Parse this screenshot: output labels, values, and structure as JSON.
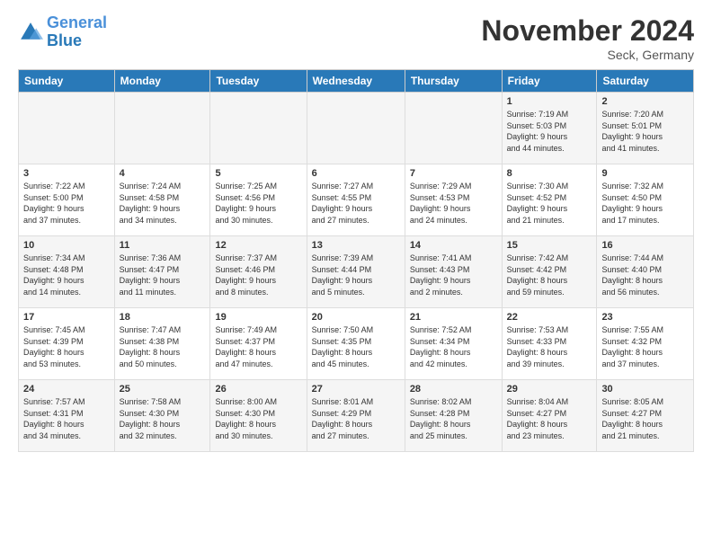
{
  "header": {
    "logo_line1": "General",
    "logo_line2": "Blue",
    "month": "November 2024",
    "location": "Seck, Germany"
  },
  "columns": [
    "Sunday",
    "Monday",
    "Tuesday",
    "Wednesday",
    "Thursday",
    "Friday",
    "Saturday"
  ],
  "weeks": [
    [
      {
        "day": "",
        "info": ""
      },
      {
        "day": "",
        "info": ""
      },
      {
        "day": "",
        "info": ""
      },
      {
        "day": "",
        "info": ""
      },
      {
        "day": "",
        "info": ""
      },
      {
        "day": "1",
        "info": "Sunrise: 7:19 AM\nSunset: 5:03 PM\nDaylight: 9 hours\nand 44 minutes."
      },
      {
        "day": "2",
        "info": "Sunrise: 7:20 AM\nSunset: 5:01 PM\nDaylight: 9 hours\nand 41 minutes."
      }
    ],
    [
      {
        "day": "3",
        "info": "Sunrise: 7:22 AM\nSunset: 5:00 PM\nDaylight: 9 hours\nand 37 minutes."
      },
      {
        "day": "4",
        "info": "Sunrise: 7:24 AM\nSunset: 4:58 PM\nDaylight: 9 hours\nand 34 minutes."
      },
      {
        "day": "5",
        "info": "Sunrise: 7:25 AM\nSunset: 4:56 PM\nDaylight: 9 hours\nand 30 minutes."
      },
      {
        "day": "6",
        "info": "Sunrise: 7:27 AM\nSunset: 4:55 PM\nDaylight: 9 hours\nand 27 minutes."
      },
      {
        "day": "7",
        "info": "Sunrise: 7:29 AM\nSunset: 4:53 PM\nDaylight: 9 hours\nand 24 minutes."
      },
      {
        "day": "8",
        "info": "Sunrise: 7:30 AM\nSunset: 4:52 PM\nDaylight: 9 hours\nand 21 minutes."
      },
      {
        "day": "9",
        "info": "Sunrise: 7:32 AM\nSunset: 4:50 PM\nDaylight: 9 hours\nand 17 minutes."
      }
    ],
    [
      {
        "day": "10",
        "info": "Sunrise: 7:34 AM\nSunset: 4:48 PM\nDaylight: 9 hours\nand 14 minutes."
      },
      {
        "day": "11",
        "info": "Sunrise: 7:36 AM\nSunset: 4:47 PM\nDaylight: 9 hours\nand 11 minutes."
      },
      {
        "day": "12",
        "info": "Sunrise: 7:37 AM\nSunset: 4:46 PM\nDaylight: 9 hours\nand 8 minutes."
      },
      {
        "day": "13",
        "info": "Sunrise: 7:39 AM\nSunset: 4:44 PM\nDaylight: 9 hours\nand 5 minutes."
      },
      {
        "day": "14",
        "info": "Sunrise: 7:41 AM\nSunset: 4:43 PM\nDaylight: 9 hours\nand 2 minutes."
      },
      {
        "day": "15",
        "info": "Sunrise: 7:42 AM\nSunset: 4:42 PM\nDaylight: 8 hours\nand 59 minutes."
      },
      {
        "day": "16",
        "info": "Sunrise: 7:44 AM\nSunset: 4:40 PM\nDaylight: 8 hours\nand 56 minutes."
      }
    ],
    [
      {
        "day": "17",
        "info": "Sunrise: 7:45 AM\nSunset: 4:39 PM\nDaylight: 8 hours\nand 53 minutes."
      },
      {
        "day": "18",
        "info": "Sunrise: 7:47 AM\nSunset: 4:38 PM\nDaylight: 8 hours\nand 50 minutes."
      },
      {
        "day": "19",
        "info": "Sunrise: 7:49 AM\nSunset: 4:37 PM\nDaylight: 8 hours\nand 47 minutes."
      },
      {
        "day": "20",
        "info": "Sunrise: 7:50 AM\nSunset: 4:35 PM\nDaylight: 8 hours\nand 45 minutes."
      },
      {
        "day": "21",
        "info": "Sunrise: 7:52 AM\nSunset: 4:34 PM\nDaylight: 8 hours\nand 42 minutes."
      },
      {
        "day": "22",
        "info": "Sunrise: 7:53 AM\nSunset: 4:33 PM\nDaylight: 8 hours\nand 39 minutes."
      },
      {
        "day": "23",
        "info": "Sunrise: 7:55 AM\nSunset: 4:32 PM\nDaylight: 8 hours\nand 37 minutes."
      }
    ],
    [
      {
        "day": "24",
        "info": "Sunrise: 7:57 AM\nSunset: 4:31 PM\nDaylight: 8 hours\nand 34 minutes."
      },
      {
        "day": "25",
        "info": "Sunrise: 7:58 AM\nSunset: 4:30 PM\nDaylight: 8 hours\nand 32 minutes."
      },
      {
        "day": "26",
        "info": "Sunrise: 8:00 AM\nSunset: 4:30 PM\nDaylight: 8 hours\nand 30 minutes."
      },
      {
        "day": "27",
        "info": "Sunrise: 8:01 AM\nSunset: 4:29 PM\nDaylight: 8 hours\nand 27 minutes."
      },
      {
        "day": "28",
        "info": "Sunrise: 8:02 AM\nSunset: 4:28 PM\nDaylight: 8 hours\nand 25 minutes."
      },
      {
        "day": "29",
        "info": "Sunrise: 8:04 AM\nSunset: 4:27 PM\nDaylight: 8 hours\nand 23 minutes."
      },
      {
        "day": "30",
        "info": "Sunrise: 8:05 AM\nSunset: 4:27 PM\nDaylight: 8 hours\nand 21 minutes."
      }
    ]
  ]
}
